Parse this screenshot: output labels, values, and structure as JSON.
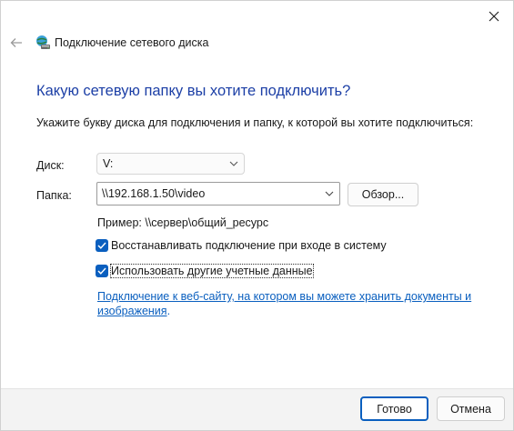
{
  "window": {
    "title": "Подключение сетевого диска"
  },
  "content": {
    "heading": "Какую сетевую папку вы хотите подключить?",
    "instruction": "Укажите букву диска для подключения и папку, к которой вы хотите подключиться:"
  },
  "drive": {
    "label": "Диск:",
    "value": "V:"
  },
  "folder": {
    "label": "Папка:",
    "value": "\\\\192.168.1.50\\video",
    "browse_label": "Обзор..."
  },
  "example": "Пример: \\\\сервер\\общий_ресурс",
  "options": {
    "reconnect_label": "Восстанавливать подключение при входе в систему",
    "reconnect_checked": true,
    "other_credentials_label": "Использовать другие учетные данные",
    "other_credentials_checked": true
  },
  "link": {
    "text": "Подключение к веб-сайту, на котором вы можете хранить документы и изображения",
    "trailing": "."
  },
  "buttons": {
    "finish_label": "Готово",
    "cancel_label": "Отмена"
  },
  "colors": {
    "accent": "#0a5fbf",
    "heading": "#1c3fa6"
  },
  "icons": {
    "close": "close-icon",
    "back": "back-arrow-icon",
    "app": "network-drive-icon",
    "chevron": "chevron-down-icon",
    "check": "check-icon"
  }
}
